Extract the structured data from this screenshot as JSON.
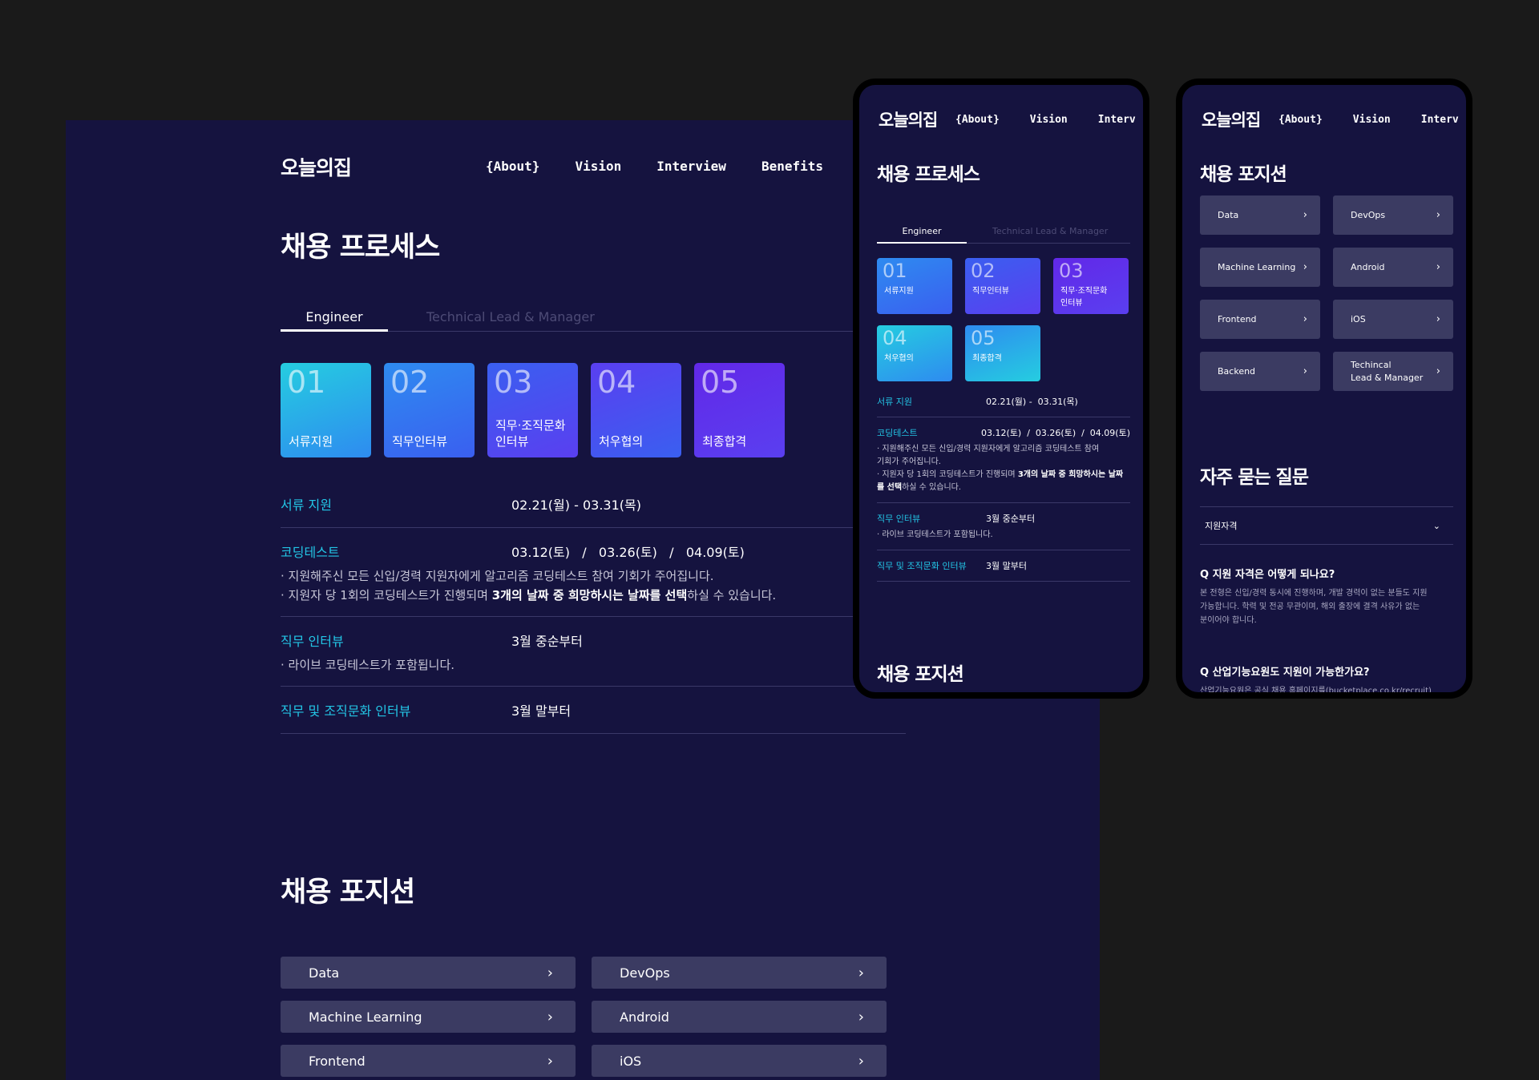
{
  "brand": {
    "logo": "오늘의집"
  },
  "nav": {
    "about": "{About}",
    "vision": "Vision",
    "interview": "Interview",
    "benefits": "Benefits",
    "interview_cut": "Interv"
  },
  "process": {
    "title": "채용 프로세스",
    "tab_engineer": "Engineer",
    "tab_lead": "Technical Lead & Manager",
    "steps": [
      {
        "num": "01",
        "label": "서류지원"
      },
      {
        "num": "02",
        "label": "직무인터뷰"
      },
      {
        "num": "03",
        "label": "직무·조직문화\n인터뷰"
      },
      {
        "num": "04",
        "label": "처우협의"
      },
      {
        "num": "05",
        "label": "최종합격"
      }
    ],
    "step_colors": [
      "#25cde0",
      "#2e8bf0",
      "#3a5ff0",
      "#5a3ff0",
      "#6228e8"
    ],
    "rows": {
      "r1_key": "서류 지원",
      "r1_val": "02.21(월) - 03.31(목)",
      "r2_key": "코딩테스트",
      "r2_val": "03.12(토)   /   03.26(토)   /   04.09(토)",
      "r2_note1": "· 지원해주신 모든 신입/경력 지원자에게 알고리즘 코딩테스트 참여 기회가 주어집니다.",
      "r2_note2_a": "· 지원자 당 1회의 코딩테스트가 진행되며 ",
      "r2_note2_b": "3개의 날짜 중 희망하시는 날짜를 선택",
      "r2_note2_c": "하실 수 있습니다.",
      "r3_key": "직무 인터뷰",
      "r3_val": "3월 중순부터",
      "r3_note": "· 라이브 코딩테스트가 포함됩니다.",
      "r4_key": "직무 및 조직문화 인터뷰",
      "r4_val": "3월 말부터"
    },
    "mobile": {
      "r1_val": "02.21(월) -  03.31(목)",
      "r2_val": "03.12(토)  /  03.26(토)  /  04.09(토)",
      "r2_note1": "· 지원해주신 모든 신입/경력 지원자에게 알고리즘 코딩테스트 참여\n  기회가 주어집니다.",
      "r2_note2_a": "· 지원자 당 1회의 코딩테스트가 진행되며 ",
      "r2_note2_b": "3개의 날짜 중 희망하시는 날짜를 선택",
      "r2_note2_c": "하실 수 있습니다.",
      "r3_note": "· 라이브 코딩테스트가 포함됩니다."
    }
  },
  "positions": {
    "title": "채용 포지션",
    "items": [
      "Data",
      "DevOps",
      "Machine Learning",
      "Android",
      "Frontend",
      "iOS",
      "Backend",
      "Techincal\nLead & Manager"
    ]
  },
  "faq": {
    "title": "자주 묻는 질문",
    "filter": "지원자격",
    "q1": "Q  지원 자격은 어떻게 되나요?",
    "a1": "본 전형은 신입/경력 동시에 진행하며, 개발 경력이 없는 분들도 지원\n가능합니다. 학력 및 전공 무관이며, 해외 출장에 결격 사유가 없는\n분이어야 합니다.",
    "q2": "Q  산업기능요원도 지원이 가능한가요?",
    "a2": "산업기능요원은 공식 채용 홈페이지를(bucketplace.co.kr/recruit)"
  },
  "colors": {
    "background": "#1a1a1a",
    "panel": "#15133f",
    "accent": "#23c6e6",
    "button": "#3b3b62"
  }
}
